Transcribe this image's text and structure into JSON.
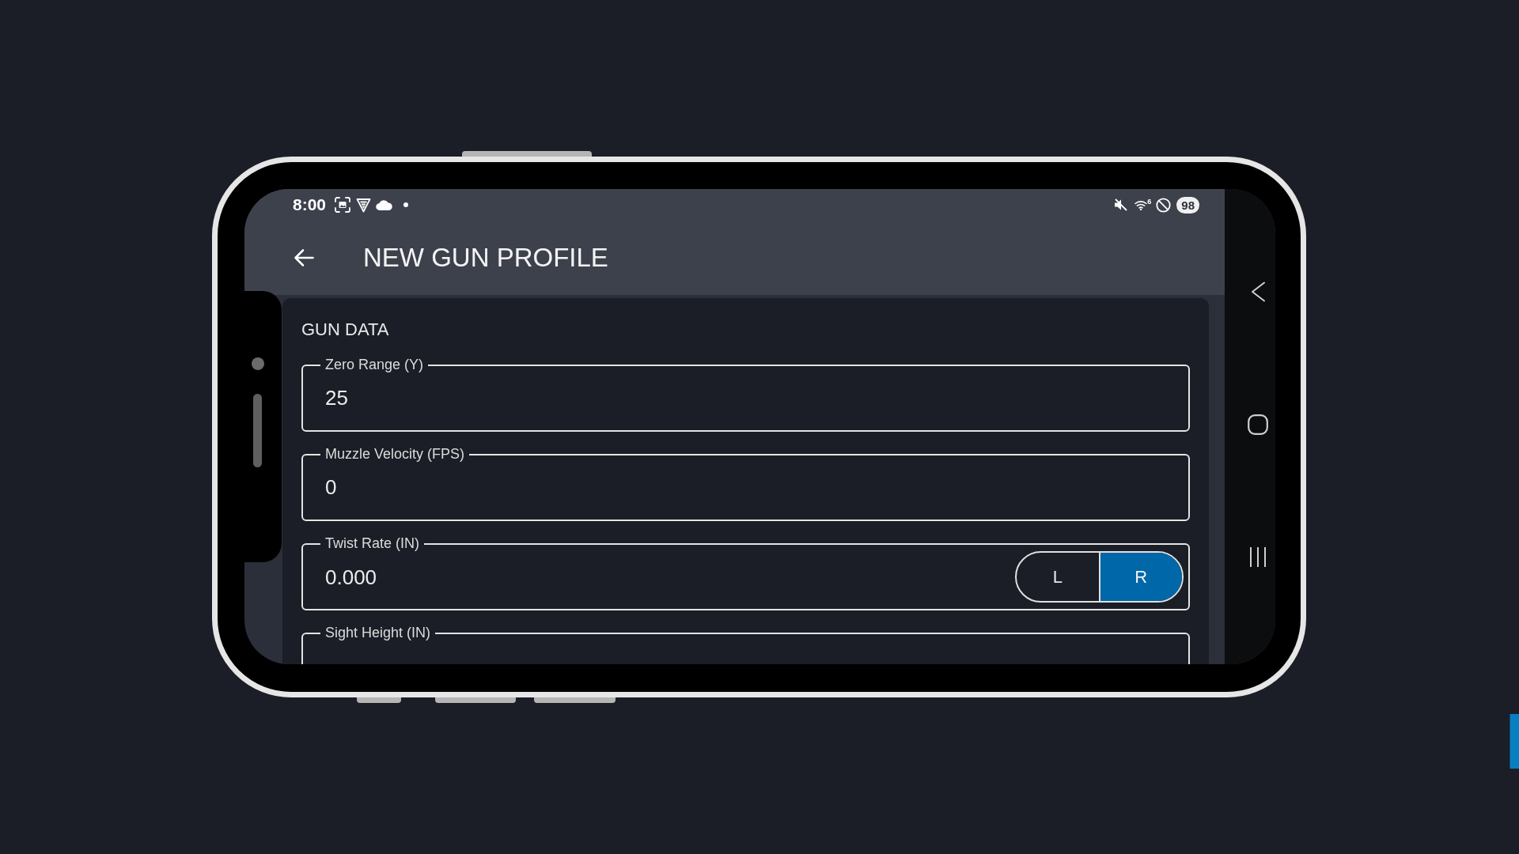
{
  "status_bar": {
    "time": "8:00",
    "wifi_badge": "6",
    "battery": "98"
  },
  "header": {
    "title": "NEW GUN PROFILE"
  },
  "form": {
    "section_title": "GUN DATA",
    "fields": [
      {
        "kind": "text",
        "label": "Zero Range (Y)",
        "value": "25"
      },
      {
        "kind": "text",
        "label": "Muzzle Velocity (FPS)",
        "value": "0"
      },
      {
        "kind": "toggle",
        "label": "Twist Rate (IN)",
        "value": "0.000",
        "options": [
          {
            "label": "L",
            "selected": false
          },
          {
            "label": "R",
            "selected": true
          }
        ]
      },
      {
        "kind": "text",
        "label": "Sight Height (IN)"
      }
    ]
  }
}
